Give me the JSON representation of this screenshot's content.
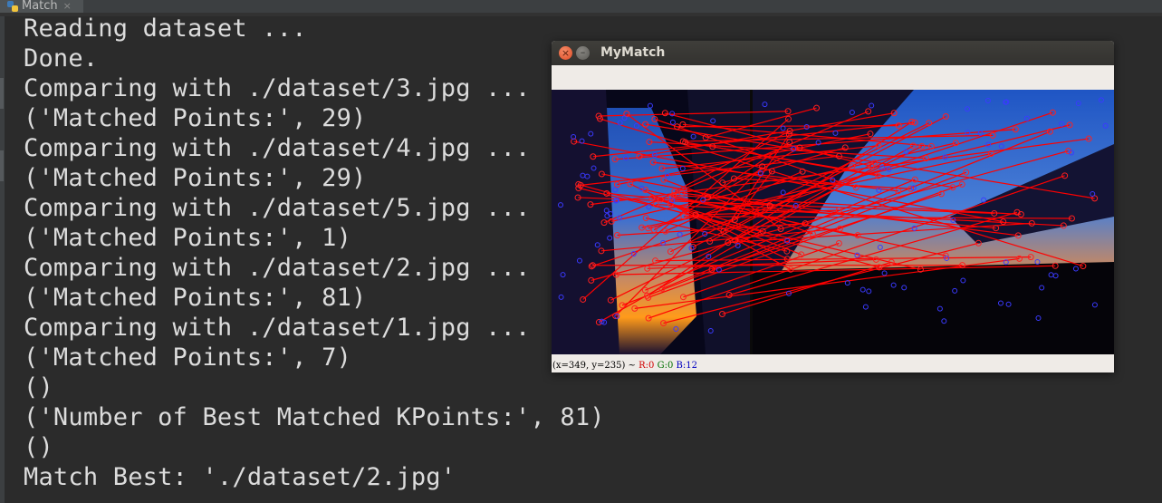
{
  "ide": {
    "tab": {
      "title": "Match",
      "close_glyph": "×",
      "icon": "python-icon"
    }
  },
  "console": {
    "lines": [
      "Reading dataset ...",
      "Done.",
      "Comparing with ./dataset/3.jpg ...",
      "('Matched Points:', 29)",
      "Comparing with ./dataset/4.jpg ...",
      "('Matched Points:', 29)",
      "Comparing with ./dataset/5.jpg ...",
      "('Matched Points:', 1)",
      "Comparing with ./dataset/2.jpg ...",
      "('Matched Points:', 81)",
      "Comparing with ./dataset/1.jpg ...",
      "('Matched Points:', 7)",
      "()",
      "('Number of Best Matched KPoints:', 81)",
      "()",
      "Match Best: './dataset/2.jpg'"
    ]
  },
  "window": {
    "title": "MyMatch",
    "close_glyph": "×",
    "minimize_glyph": "–",
    "status": {
      "coords": "(x=349, y=235) ~",
      "r": "R:0",
      "g": "G:0",
      "b": "B:12"
    }
  }
}
